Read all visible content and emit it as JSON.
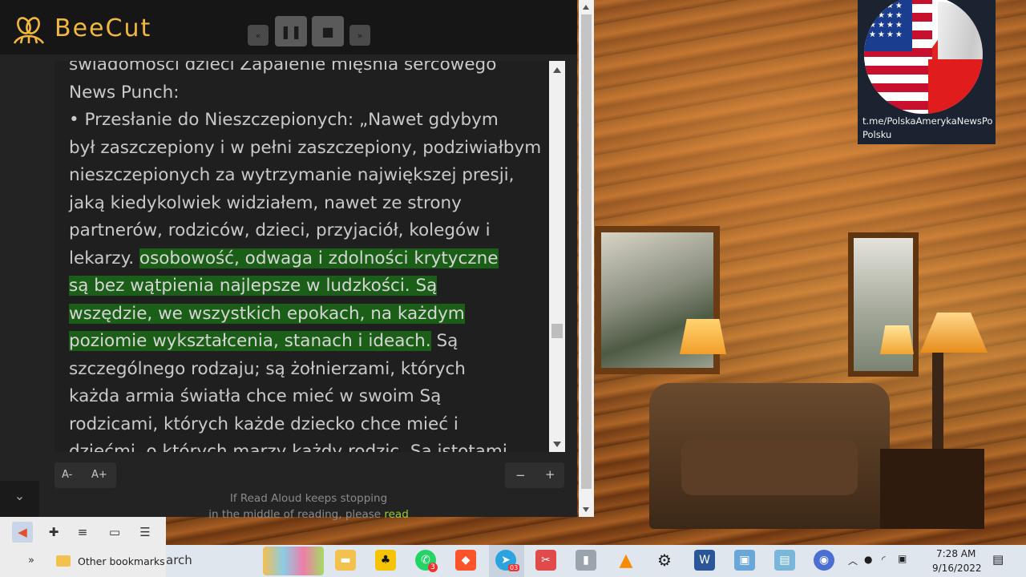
{
  "app": {
    "brand": "BeeCut",
    "controls": {
      "rewind": "«",
      "pause": "❚❚",
      "stop": "■",
      "forward": "»"
    }
  },
  "reader": {
    "lines_before": [
      "świadomości dzieci Zapalenie mięśnia sercowego",
      "News Punch:",
      "• Przesłanie do Nieszczepionych: „Nawet gdybym",
      "był zaszczepiony i w pełni zaszczepiony, podziwiałbym",
      "nieszczepionych za wytrzymanie największej presji,",
      "jaką kiedykolwiek widziałem, nawet ze strony",
      "partnerów, rodziców, dzieci, przyjaciół, kolegów i"
    ],
    "line_mixed_plain": "lekarzy.",
    "line_mixed_hl": "osobowość, odwaga i zdolności krytyczne",
    "highlight_lines": [
      "są bez wątpienia najlepsze w ludzkości. Są",
      "wszędzie, we wszystkich epokach, na każdym"
    ],
    "last_hl": "poziomie wykształcenia, stanach i ideach.",
    "after_hl": "Są",
    "lines_after": [
      "szczególnego rodzaju; są żołnierzami, których",
      "każda armia światła chce mieć w swoim Są",
      "rodzicami, których każde dziecko chce mieć i",
      "dziećmi, o których marzy każdy rodzic. Są istotami"
    ]
  },
  "font_controls": {
    "decrease": "A-",
    "increase": "A+"
  },
  "zoom_controls": {
    "minus": "−",
    "plus": "+"
  },
  "hint": {
    "line1": "If Read Aloud keeps stopping",
    "line2_prefix": "in the middle of reading, please",
    "line2_link": "read"
  },
  "watermark": {
    "url_line1": "t.me/PolskaAmerykaNewsPo",
    "url_line2": "Polsku"
  },
  "browser": {
    "chevron": "⌄",
    "bookmarks_arrow": "»",
    "bookmark_folder": "Other bookmarks"
  },
  "taskbar": {
    "search_text": "arch",
    "telegram_badge": "03",
    "whatsapp_badge": "3",
    "time": "7:28 AM",
    "date": "9/16/2022",
    "colors": {
      "telegram": "#2aa3de",
      "whatsapp": "#25d366",
      "brave": "#fb542b",
      "word": "#2b579a",
      "vlc": "#f48b00",
      "explorer": "#f2c14e"
    }
  }
}
